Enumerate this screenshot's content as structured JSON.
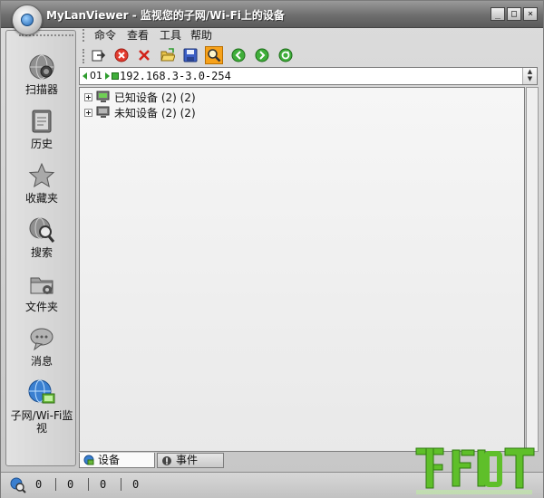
{
  "window": {
    "title": "MyLanViewer - 监视您的子网/Wi-Fi上的设备",
    "buttons": {
      "minimize": "_",
      "maximize": "□",
      "close": "×"
    }
  },
  "menu": {
    "items": [
      {
        "label": "命令"
      },
      {
        "label": "查看"
      },
      {
        "label": "工具"
      },
      {
        "label": "帮助"
      }
    ]
  },
  "sidebar": {
    "items": [
      {
        "label": "扫描器",
        "icon": "scanner-globe-icon"
      },
      {
        "label": "历史",
        "icon": "history-book-icon"
      },
      {
        "label": "收藏夹",
        "icon": "favorites-star-icon"
      },
      {
        "label": "搜索",
        "icon": "search-globe-icon"
      },
      {
        "label": "文件夹",
        "icon": "shared-folder-icon"
      },
      {
        "label": "消息",
        "icon": "message-bubble-icon"
      },
      {
        "label": "子网/Wi-Fi监视",
        "icon": "subnet-monitor-icon"
      }
    ]
  },
  "address": {
    "prefix": "01",
    "range": "192.168.3-3.0-254"
  },
  "tree": {
    "items": [
      {
        "label": "已知设备 (2) (2)",
        "icon": "known-devices-icon"
      },
      {
        "label": "未知设备 (2) (2)",
        "icon": "unknown-devices-icon"
      }
    ]
  },
  "tabs": [
    {
      "label": "设备",
      "icon": "devices-tab-icon",
      "active": true
    },
    {
      "label": "事件",
      "icon": "events-tab-icon",
      "active": false
    }
  ],
  "status": {
    "values": [
      "0",
      "0",
      "0",
      "0"
    ]
  },
  "colors": {
    "active_tool": "#f7a21b",
    "logo_green": "#5fbf2a"
  }
}
